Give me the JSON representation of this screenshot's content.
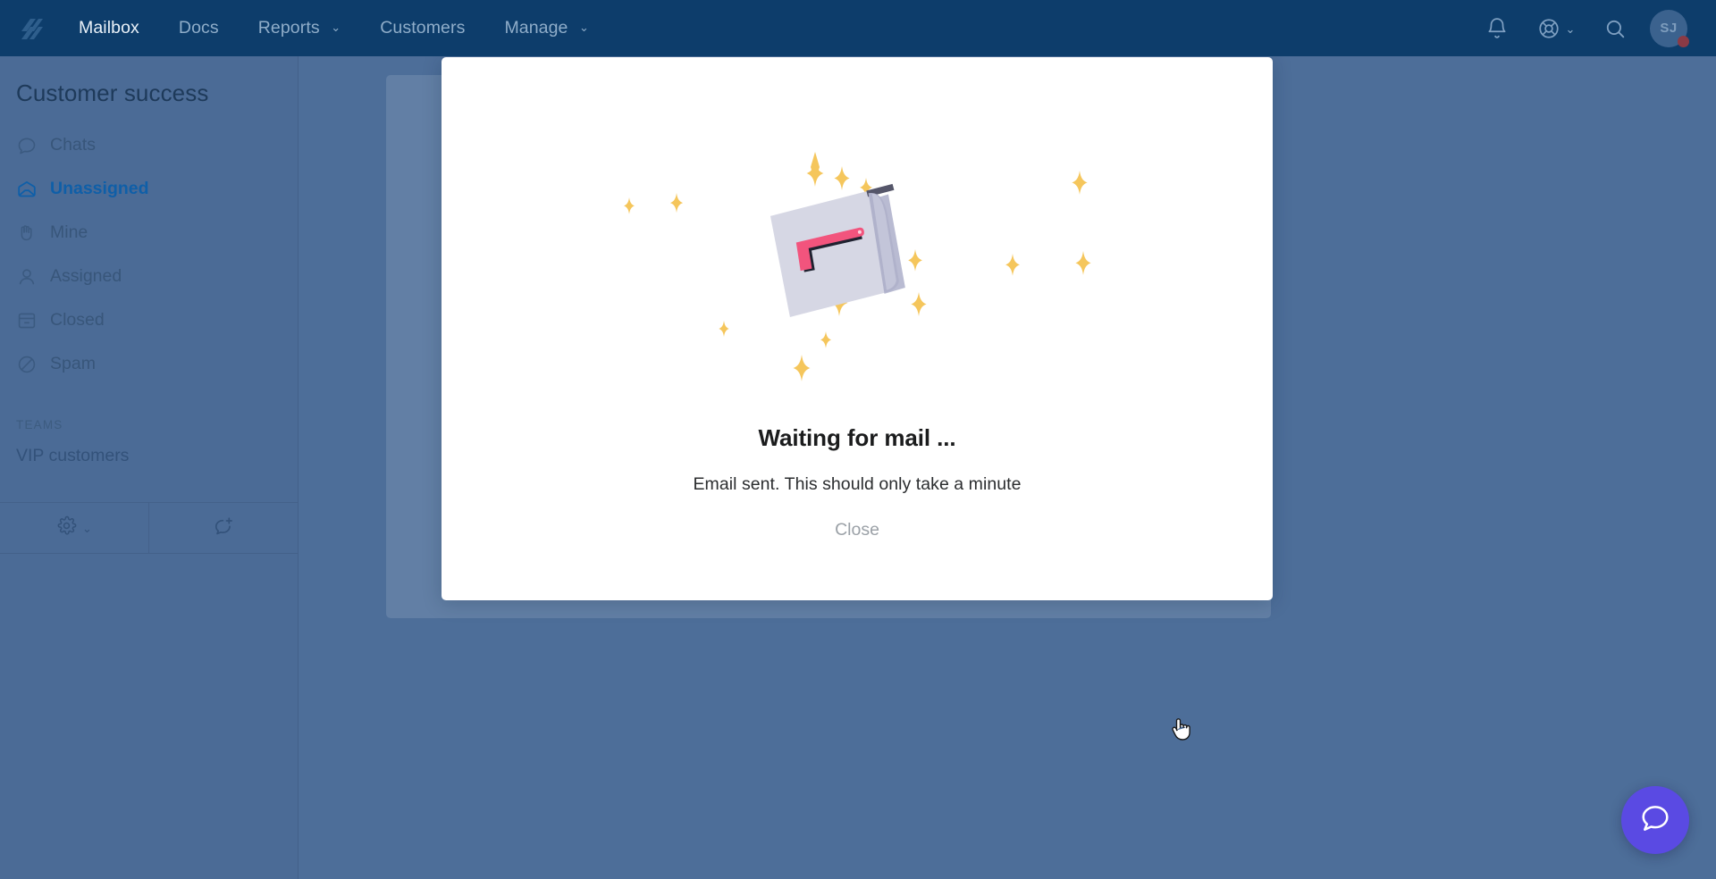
{
  "topnav": {
    "logo_icon": "helpscout-logo-icon",
    "items": [
      {
        "label": "Mailbox",
        "active": true,
        "caret": false
      },
      {
        "label": "Docs",
        "active": false,
        "caret": false
      },
      {
        "label": "Reports",
        "active": false,
        "caret": true
      },
      {
        "label": "Customers",
        "active": false,
        "caret": false
      },
      {
        "label": "Manage",
        "active": false,
        "caret": true
      }
    ],
    "caret_glyph": "⌄",
    "right_icons": [
      {
        "name": "notifications-bell-icon",
        "caret": false
      },
      {
        "name": "help-lifebuoy-icon",
        "caret": true
      },
      {
        "name": "search-icon",
        "caret": false
      }
    ],
    "avatar": {
      "initials": "SJ",
      "badge": true
    }
  },
  "sidebar": {
    "title": "Customer success",
    "items": [
      {
        "label": "Chats",
        "icon": "chat-bubble-icon",
        "active": false
      },
      {
        "label": "Unassigned",
        "icon": "open-envelope-icon",
        "active": true
      },
      {
        "label": "Mine",
        "icon": "raised-hand-icon",
        "active": false
      },
      {
        "label": "Assigned",
        "icon": "person-icon",
        "active": false
      },
      {
        "label": "Closed",
        "icon": "archive-box-icon",
        "active": false
      },
      {
        "label": "Spam",
        "icon": "block-circle-icon",
        "active": false
      }
    ],
    "section_title": "TEAMS",
    "teams": [
      {
        "label": "VIP customers"
      }
    ],
    "footer": {
      "settings_icon": "gear-icon",
      "settings_caret": "⌄",
      "new_conversation_icon": "new-conversation-icon"
    }
  },
  "modal": {
    "illustration": "mailbox-with-sparkles-illustration",
    "title": "Waiting for mail ...",
    "subtitle": "Email sent. This should only take a minute",
    "close_label": "Close"
  },
  "beacon": {
    "icon": "chat-beacon-icon"
  },
  "cursor": {
    "icon": "pointer-hand-cursor"
  },
  "colors": {
    "navbar": "#0d3d6b",
    "sidebar": "#4b6b96",
    "page_background": "#4d6e99",
    "accent_active": "#0f5fa8",
    "beacon": "#5a4ae3",
    "sparkle": "#f5c65c",
    "mailbox_body": "#d6d7e4",
    "mailbox_flag": "#f2547d",
    "avatar_badge": "#8b3a45"
  }
}
